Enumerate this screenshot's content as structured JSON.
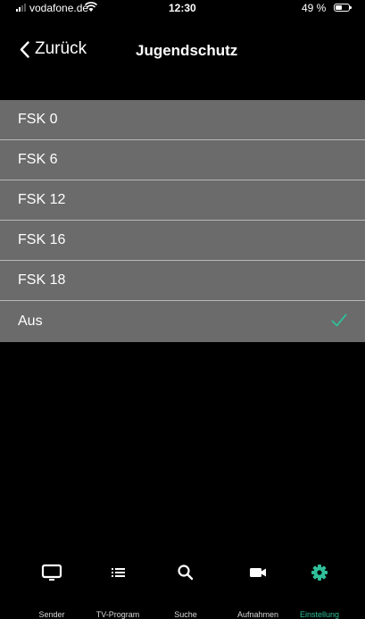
{
  "status_bar": {
    "carrier": "vodafone.de",
    "time": "12:30",
    "battery_percent": "49 %",
    "battery_level": 0.49
  },
  "nav": {
    "back_label": "Zurück",
    "title": "Jugendschutz"
  },
  "options": [
    {
      "label": "FSK 0",
      "selected": false
    },
    {
      "label": "FSK 6",
      "selected": false
    },
    {
      "label": "FSK 12",
      "selected": false
    },
    {
      "label": "FSK 16",
      "selected": false
    },
    {
      "label": "FSK 18",
      "selected": false
    },
    {
      "label": "Aus",
      "selected": true
    }
  ],
  "tab_bar": {
    "tabs": [
      {
        "label": "Sender",
        "icon": "tv-icon",
        "active": false
      },
      {
        "label": "TV-Program",
        "icon": "list-icon",
        "active": false
      },
      {
        "label": "Suche",
        "icon": "search-icon",
        "active": false
      },
      {
        "label": "Aufnahmen",
        "icon": "video-camera-icon",
        "active": false
      },
      {
        "label": "Einstellung",
        "icon": "gear-icon",
        "active": true
      }
    ]
  },
  "colors": {
    "accent": "#2fbf99",
    "list_background": "#6b6b6b",
    "separator": "#b8b8b8",
    "background": "#000000"
  }
}
